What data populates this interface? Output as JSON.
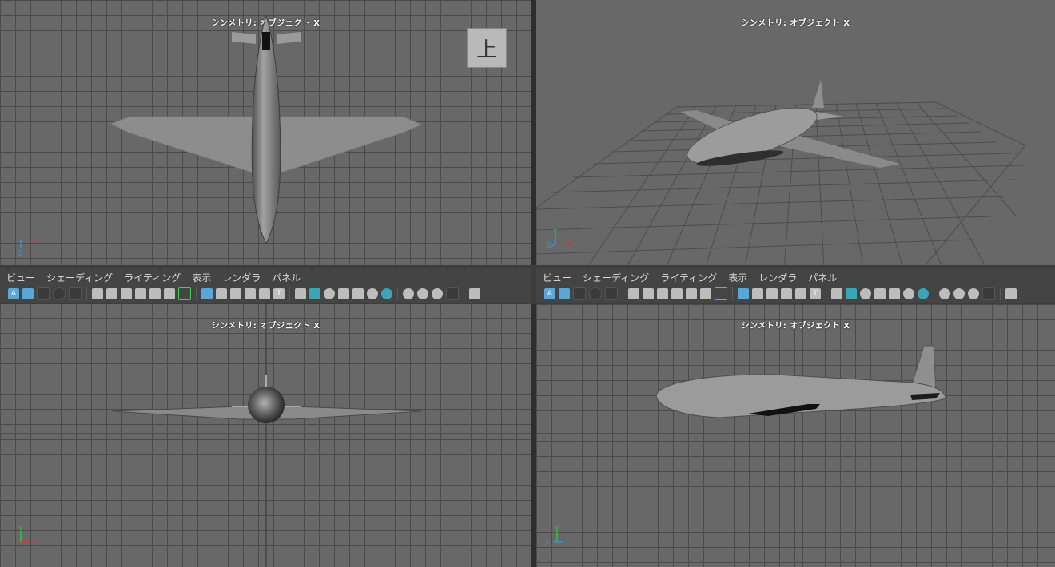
{
  "viewports": {
    "top_left": {
      "title": "シンメトリ: オブジェクト X",
      "view_cube_label": "上"
    },
    "top_right": {
      "title": "シンメトリ: オブジェクト X"
    },
    "bottom_left": {
      "title": "シンメトリ: オブジェクト X"
    },
    "bottom_right": {
      "title": "シンメトリ: オブジェクト X"
    }
  },
  "panel_menu": [
    "ビュー",
    "シェーディング",
    "ライティング",
    "表示",
    "レンダラ",
    "パネル"
  ],
  "axes": {
    "x": "X",
    "y": "Y",
    "z": "Z"
  },
  "toolbar_icons": [
    "camera-select-icon",
    "camera-attributes-icon",
    "image-plane-icon",
    "bookmark-icon",
    "2d-pan-zoom-icon",
    "grease-pencil-icon",
    "grid-icon",
    "film-gate-icon",
    "resolution-gate-icon",
    "gate-mask-icon",
    "field-chart-icon",
    "safe-action-icon",
    "safe-title-icon",
    "wireframe-icon",
    "smooth-shade-icon",
    "flat-shade-icon",
    "bounding-box-icon",
    "textured-icon",
    "lights-icon",
    "shadows-icon",
    "ambient-occlusion-icon",
    "motion-blur-icon",
    "anti-aliasing-icon",
    "depth-of-field-icon",
    "isolate-select-icon",
    "xray-icon"
  ],
  "colors": {
    "viewport_bg": "#686868",
    "grid_line": "#4a4a4a",
    "panel_bg": "#444444",
    "accent_blue": "#5aa6d6",
    "accent_green": "#39d54a"
  }
}
